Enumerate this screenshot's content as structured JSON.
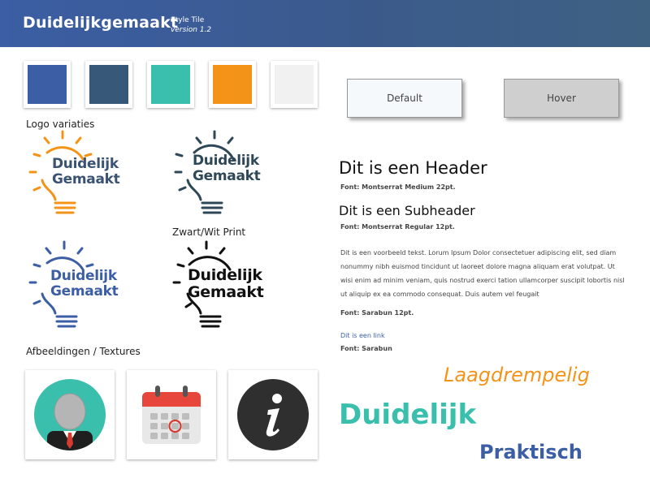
{
  "header": {
    "brand": "Duidelijkgemaakt",
    "style_title": "Style Tile",
    "version": "version 1.2"
  },
  "colors": {
    "swatches": [
      "#3b5ea4",
      "#38587a",
      "#3bbfad",
      "#f39419",
      "#f1f1f1"
    ]
  },
  "logos": {
    "section_label": "Logo variaties",
    "bw_label": "Zwart/Wit Print",
    "line1": "Duidelijk",
    "line2": "Gemaakt",
    "variants": [
      {
        "name": "orange",
        "bulb": "#f39419",
        "text": "#3b5373"
      },
      {
        "name": "dark",
        "bulb": "#2f4858",
        "text": "#2f4858"
      },
      {
        "name": "blue",
        "bulb": "#3b5ea4",
        "text": "#3b5ea4"
      },
      {
        "name": "black",
        "bulb": "#111111",
        "text": "#111111"
      }
    ]
  },
  "buttons": {
    "default_label": "Default",
    "hover_label": "Hover"
  },
  "typography": {
    "header": "Dit is een Header",
    "header_font": "Font: Montserrat Medium 22pt.",
    "subheader": "Dit is een Subheader",
    "subheader_font": "Font: Montserrat Regular 12pt.",
    "body": "Dit is een voorbeeld tekst. Lorum Ipsum Dolor consectetuer adipiscing elit, sed diam nonummy nibh euismod tincidunt ut laoreet dolore magna aliquam erat volutpat. Ut wisi enim ad minim veniam, quis nostrud exerci tation ullamcorper suscipit lobortis nisl ut aliquip ex ea commodo consequat. Duis autem vel feugait",
    "body_font": "Font: Sarabun 12pt.",
    "link": "Dit is een link",
    "link_font": "Font: Sarabun"
  },
  "images": {
    "section_label": "Afbeeldingen / Textures",
    "items": [
      "user-avatar-icon",
      "calendar-icon",
      "info-icon"
    ]
  },
  "keywords": [
    "Laagdrempelig",
    "Duidelijk",
    "Praktisch"
  ]
}
